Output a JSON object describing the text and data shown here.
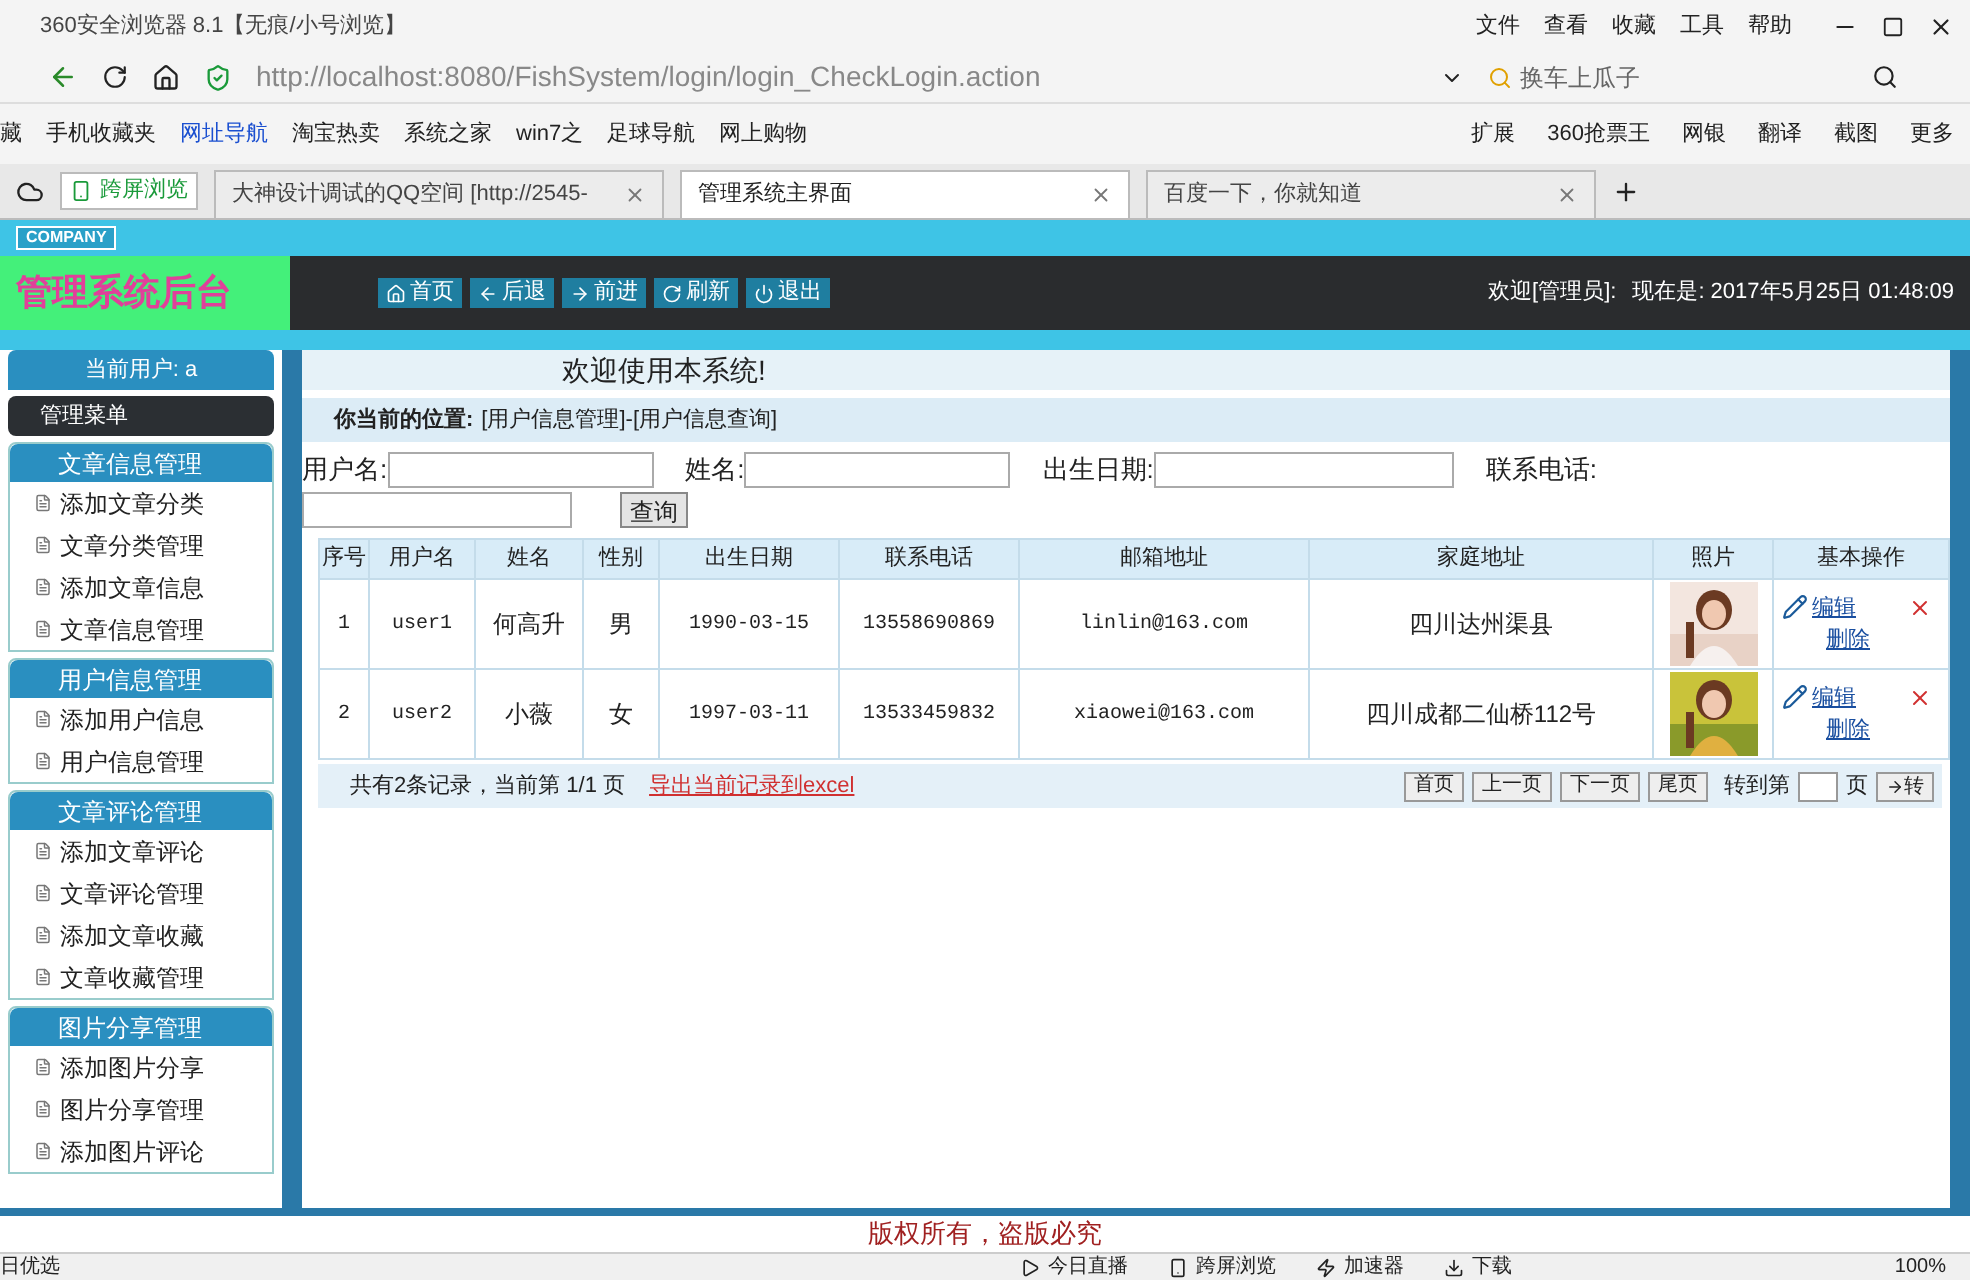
{
  "browser": {
    "title": "360安全浏览器 8.1【无痕/小号浏览】",
    "menu": [
      "文件",
      "查看",
      "收藏",
      "工具",
      "帮助"
    ],
    "url": "http://localhost:8080/FishSystem/login/login_CheckLogin.action",
    "search_placeholder": "换车上瓜子",
    "bookmarks": [
      "藏",
      "手机收藏夹",
      "网址导航",
      "淘宝热卖",
      "系统之家",
      "win7之",
      "足球导航",
      "网上购物"
    ],
    "extensions": [
      "扩展",
      "360抢票王",
      "网银",
      "翻译",
      "截图",
      "更多"
    ],
    "cross_screen": "跨屏浏览",
    "tabs": [
      {
        "label": "大神设计调试的QQ空间 [http://2545-",
        "selected": false
      },
      {
        "label": "管理系统主界面",
        "selected": true
      },
      {
        "label": "百度一下，你就知道",
        "selected": false
      }
    ]
  },
  "header": {
    "company": "COMPANY",
    "logo": "管理系统后台",
    "nav": [
      "首页",
      "后退",
      "前进",
      "刷新",
      "退出"
    ],
    "welcome": "欢迎[管理员]:",
    "clock": "现在是: 2017年5月25日 01:48:09"
  },
  "sidebar": {
    "current_user": "当前用户: a",
    "menu_title": "管理菜单",
    "groups": [
      {
        "title": "文章信息管理",
        "items": [
          "添加文章分类",
          "文章分类管理",
          "添加文章信息",
          "文章信息管理"
        ]
      },
      {
        "title": "用户信息管理",
        "items": [
          "添加用户信息",
          "用户信息管理"
        ]
      },
      {
        "title": "文章评论管理",
        "items": [
          "添加文章评论",
          "文章评论管理",
          "添加文章收藏",
          "文章收藏管理"
        ]
      },
      {
        "title": "图片分享管理",
        "items": [
          "添加图片分享",
          "图片分享管理",
          "添加图片评论"
        ]
      }
    ]
  },
  "content": {
    "title": "欢迎使用本系统!",
    "location_label": "你当前的位置:",
    "location": "[用户信息管理]-[用户信息查询]",
    "search_fields": [
      "用户名:",
      "姓名:",
      "出生日期:",
      "联系电话:"
    ],
    "query_button": "查询",
    "table": {
      "columns": [
        "序号",
        "用户名",
        "姓名",
        "性别",
        "出生日期",
        "联系电话",
        "邮箱地址",
        "家庭地址",
        "照片",
        "基本操作"
      ],
      "rows": [
        {
          "cells": [
            "1",
            "user1",
            "何高升",
            "男",
            "1990-03-15",
            "13558690869",
            "linlin@163.com",
            "四川达州渠县"
          ],
          "edit": "编辑",
          "delete": "删除"
        },
        {
          "cells": [
            "2",
            "user2",
            "小薇",
            "女",
            "1997-03-11",
            "13533459832",
            "xiaowei@163.com",
            "四川成都二仙桥112号"
          ],
          "edit": "编辑",
          "delete": "删除"
        }
      ]
    },
    "summary": "共有2条记录，当前第 1/1 页",
    "export_link": "导出当前记录到excel",
    "pager": [
      "首页",
      "上一页",
      "下一页",
      "尾页"
    ],
    "goto_label": "转到第",
    "page_unit": "页",
    "go_button": "转"
  },
  "copyright": "版权所有，盗版必究",
  "status_bar": {
    "left": "日优选",
    "items": [
      "今日直播",
      "跨屏浏览",
      "加速器",
      "下载"
    ],
    "zoom": "100%"
  }
}
